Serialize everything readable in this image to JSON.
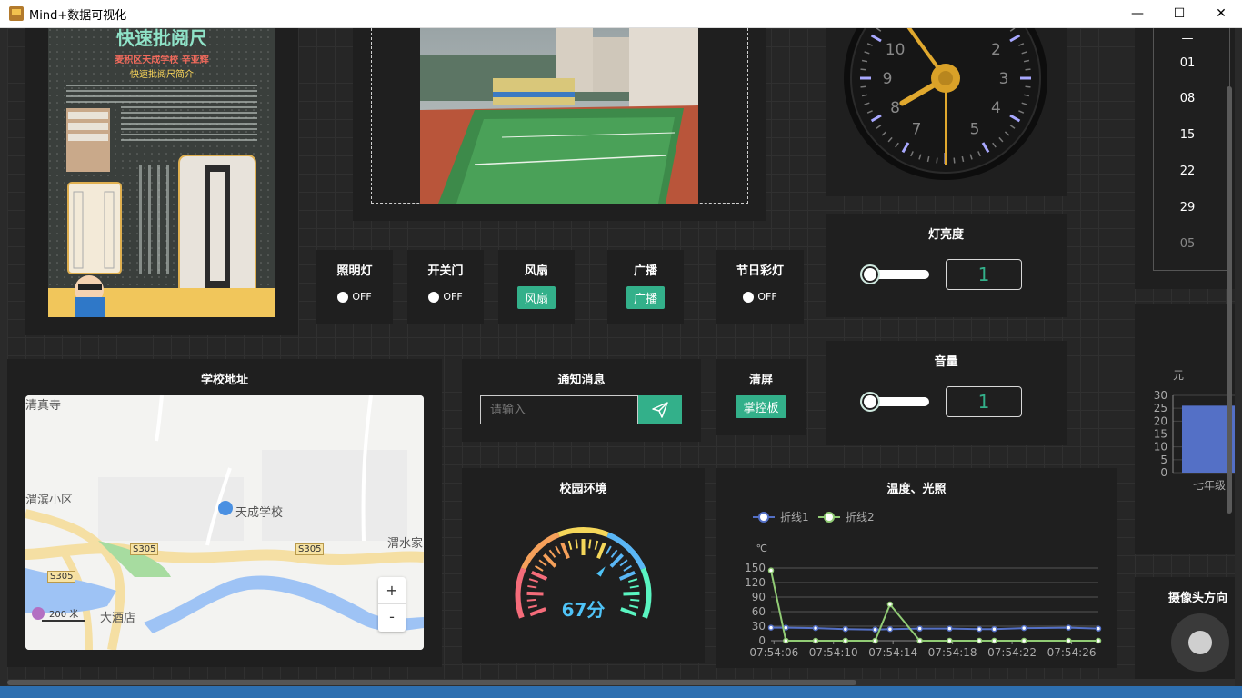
{
  "window": {
    "title": "Mind+数据可视化",
    "minimize": "—",
    "maximize": "☐",
    "close": "✕"
  },
  "poster": {
    "heading": "快速批阅尺",
    "subheading": "麦积区天成学校  辛亚辉",
    "caption": "快速批阅尺简介"
  },
  "switches": [
    {
      "label": "照明灯",
      "type": "toggle",
      "state": "OFF"
    },
    {
      "label": "开关门",
      "type": "toggle",
      "state": "OFF"
    },
    {
      "label": "风扇",
      "type": "button",
      "button_label": "风扇"
    },
    {
      "label": "广播",
      "type": "button",
      "button_label": "广播"
    },
    {
      "label": "节日彩灯",
      "type": "toggle",
      "state": "OFF"
    }
  ],
  "clock": {
    "numbers": [
      "10",
      "2",
      "9",
      "3",
      "8",
      "4",
      "7",
      "5"
    ],
    "hour_hand_value": 8.0,
    "minute_hand_value": 54
  },
  "date_picker": {
    "items": [
      "—",
      "01",
      "08",
      "15",
      "22",
      "29",
      "05"
    ]
  },
  "brightness": {
    "title": "灯亮度",
    "value": "1",
    "level": 0.0
  },
  "volume": {
    "title": "音量",
    "value": "1",
    "level": 0.0
  },
  "map": {
    "title": "学校地址",
    "labels": {
      "temple": "清真寺",
      "district": "渭滨小区",
      "school": "天成学校",
      "area": "渭水家",
      "road1": "S305",
      "road2": "S305",
      "road3": "S305",
      "hotel": "大酒店",
      "scale": "200 米"
    },
    "zoom_in": "+",
    "zoom_out": "-"
  },
  "notify": {
    "title": "通知消息",
    "placeholder": "请输入"
  },
  "clear_screen": {
    "title": "清屏",
    "button_label": "掌控板"
  },
  "environment": {
    "title": "校园环境",
    "score_text": "67分",
    "score": 67
  },
  "right_bar": {
    "unit": "元",
    "ticks": [
      "30",
      "25",
      "20",
      "15",
      "10",
      "5",
      "0"
    ],
    "category": "七年级",
    "value": 26
  },
  "camera": {
    "title": "摄像头方向"
  },
  "colors": {
    "accent": "#33b08a",
    "line1": "#5470c6",
    "line2": "#91cc75",
    "panel": "#1f1f1f"
  },
  "chart_data": {
    "type": "line",
    "title": "温度、光照",
    "ylabel": "℃",
    "ylim": [
      0,
      150
    ],
    "yticks": [
      "150",
      "120",
      "90",
      "60",
      "30",
      "0"
    ],
    "x_tick_labels": [
      "07:54:06",
      "07:54:10",
      "07:54:14",
      "07:54:18",
      "07:54:22",
      "07:54:26"
    ],
    "x": [
      0,
      1,
      3,
      5,
      7,
      8,
      10,
      12,
      14,
      15,
      17,
      20,
      22
    ],
    "series": [
      {
        "name": "折线1",
        "values": [
          27,
          27,
          26,
          24,
          23,
          24,
          25,
          25,
          24,
          24,
          26,
          27,
          25
        ]
      },
      {
        "name": "折线2",
        "values": [
          145,
          0,
          0,
          0,
          0,
          75,
          0,
          0,
          0,
          0,
          0,
          0,
          0
        ]
      }
    ],
    "legend_position": "top-left",
    "grid": true
  }
}
